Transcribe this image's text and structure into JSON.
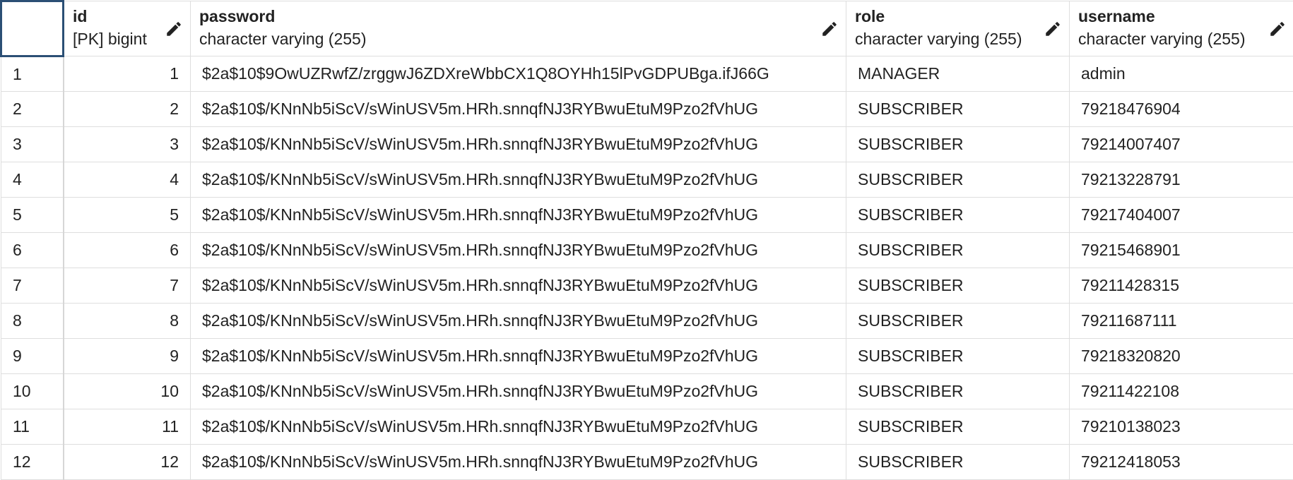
{
  "columns": [
    {
      "name": "id",
      "type": "[PK] bigint"
    },
    {
      "name": "password",
      "type": "character varying (255)"
    },
    {
      "name": "role",
      "type": "character varying (255)"
    },
    {
      "name": "username",
      "type": "character varying (255)"
    }
  ],
  "icons": {
    "edit": "pencil-icon"
  },
  "colors": {
    "selected_cell_border": "#2b4f75",
    "grid_line": "#dedede"
  },
  "rows": [
    {
      "row": "1",
      "id": "1",
      "password": "$2a$10$9OwUZRwfZ/zrggwJ6ZDXreWbbCX1Q8OYHh15lPvGDPUBga.ifJ66G",
      "role": "MANAGER",
      "username": "admin"
    },
    {
      "row": "2",
      "id": "2",
      "password": "$2a$10$/KNnNb5iScV/sWinUSV5m.HRh.snnqfNJ3RYBwuEtuM9Pzo2fVhUG",
      "role": "SUBSCRIBER",
      "username": "79218476904"
    },
    {
      "row": "3",
      "id": "3",
      "password": "$2a$10$/KNnNb5iScV/sWinUSV5m.HRh.snnqfNJ3RYBwuEtuM9Pzo2fVhUG",
      "role": "SUBSCRIBER",
      "username": "79214007407"
    },
    {
      "row": "4",
      "id": "4",
      "password": "$2a$10$/KNnNb5iScV/sWinUSV5m.HRh.snnqfNJ3RYBwuEtuM9Pzo2fVhUG",
      "role": "SUBSCRIBER",
      "username": "79213228791"
    },
    {
      "row": "5",
      "id": "5",
      "password": "$2a$10$/KNnNb5iScV/sWinUSV5m.HRh.snnqfNJ3RYBwuEtuM9Pzo2fVhUG",
      "role": "SUBSCRIBER",
      "username": "79217404007"
    },
    {
      "row": "6",
      "id": "6",
      "password": "$2a$10$/KNnNb5iScV/sWinUSV5m.HRh.snnqfNJ3RYBwuEtuM9Pzo2fVhUG",
      "role": "SUBSCRIBER",
      "username": "79215468901"
    },
    {
      "row": "7",
      "id": "7",
      "password": "$2a$10$/KNnNb5iScV/sWinUSV5m.HRh.snnqfNJ3RYBwuEtuM9Pzo2fVhUG",
      "role": "SUBSCRIBER",
      "username": "79211428315"
    },
    {
      "row": "8",
      "id": "8",
      "password": "$2a$10$/KNnNb5iScV/sWinUSV5m.HRh.snnqfNJ3RYBwuEtuM9Pzo2fVhUG",
      "role": "SUBSCRIBER",
      "username": "79211687111"
    },
    {
      "row": "9",
      "id": "9",
      "password": "$2a$10$/KNnNb5iScV/sWinUSV5m.HRh.snnqfNJ3RYBwuEtuM9Pzo2fVhUG",
      "role": "SUBSCRIBER",
      "username": "79218320820"
    },
    {
      "row": "10",
      "id": "10",
      "password": "$2a$10$/KNnNb5iScV/sWinUSV5m.HRh.snnqfNJ3RYBwuEtuM9Pzo2fVhUG",
      "role": "SUBSCRIBER",
      "username": "79211422108"
    },
    {
      "row": "11",
      "id": "11",
      "password": "$2a$10$/KNnNb5iScV/sWinUSV5m.HRh.snnqfNJ3RYBwuEtuM9Pzo2fVhUG",
      "role": "SUBSCRIBER",
      "username": "79210138023"
    },
    {
      "row": "12",
      "id": "12",
      "password": "$2a$10$/KNnNb5iScV/sWinUSV5m.HRh.snnqfNJ3RYBwuEtuM9Pzo2fVhUG",
      "role": "SUBSCRIBER",
      "username": "79212418053"
    }
  ]
}
